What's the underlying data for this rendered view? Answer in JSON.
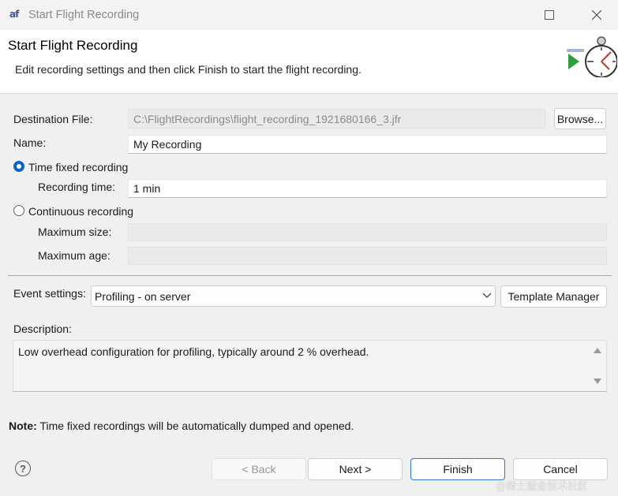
{
  "window": {
    "title": "Start Flight Recording",
    "app_icon": "jmc-app-icon"
  },
  "banner": {
    "title": "Start Flight Recording",
    "message": "Edit recording settings and then click Finish to start the flight recording."
  },
  "form": {
    "destination_label": "Destination File:",
    "destination_value": "C:\\FlightRecordings\\flight_recording_1921680166_3.jfr",
    "browse_label": "Browse...",
    "name_label": "Name:",
    "name_value": "My Recording",
    "time_fixed_label": "Time fixed recording",
    "time_fixed_selected": true,
    "recording_time_label": "Recording time:",
    "recording_time_value": "1 min",
    "continuous_label": "Continuous recording",
    "continuous_selected": false,
    "max_size_label": "Maximum size:",
    "max_size_value": "",
    "max_age_label": "Maximum age:",
    "max_age_value": "",
    "event_settings_label": "Event settings:",
    "event_settings_value": "Profiling - on server",
    "template_manager_label": "Template Manager",
    "description_label": "Description:",
    "description_text": "Low overhead configuration for profiling, typically around 2 % overhead."
  },
  "note": {
    "bold": "Note:",
    "text": "Time fixed recordings will be automatically dumped and opened."
  },
  "buttons": {
    "back": "< Back",
    "next": "Next >",
    "finish": "Finish",
    "cancel": "Cancel"
  },
  "colors": {
    "accent": "#0b63c8",
    "primary_border": "#2e79d6"
  },
  "watermark": "@稀土掘金技术社区"
}
